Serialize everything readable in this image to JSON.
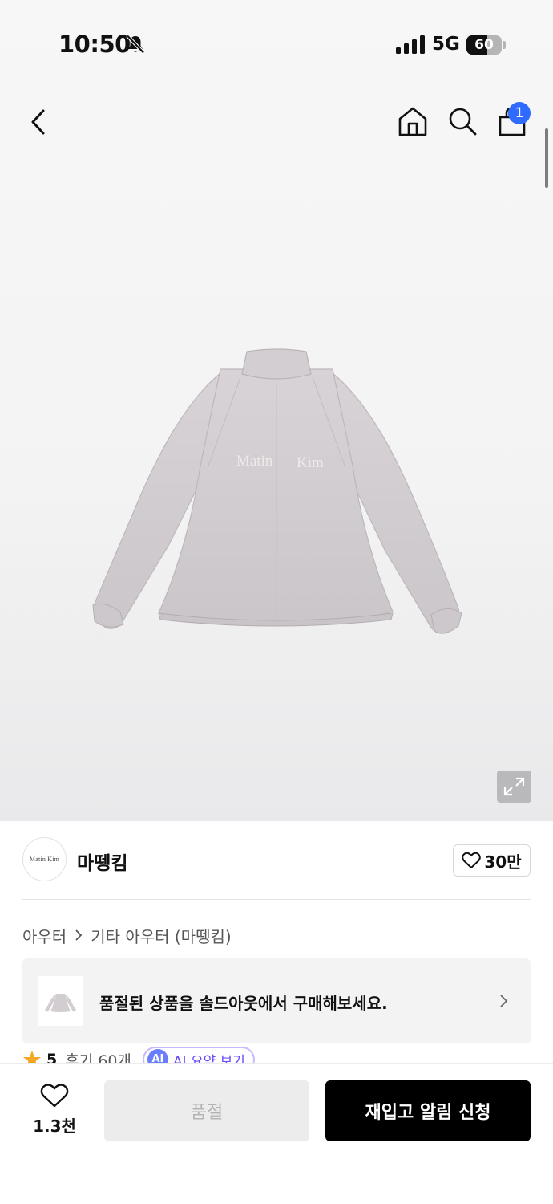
{
  "status_bar": {
    "time": "10:50",
    "network": "5G",
    "battery_level": "60",
    "battery_fraction": 0.6,
    "icons": [
      "bell-slash-icon",
      "cellular-signal-icon",
      "battery-icon"
    ]
  },
  "nav": {
    "icons": [
      "back-arrow-icon",
      "home-icon",
      "search-icon",
      "shopping-bag-icon"
    ],
    "cart_count": "1"
  },
  "product_image": {
    "print_text_1": "Matin",
    "print_text_2": "Kim",
    "zoom_icon": "expand-icon"
  },
  "brand": {
    "logo_text": "Matin  Kim",
    "name": "마뗑킴",
    "like_count": "30만"
  },
  "breadcrumb": {
    "items": [
      "아우터",
      "기타 아우터 (마뗑킴)"
    ]
  },
  "soldout_banner": {
    "text": "품절된 상품을 솔드아웃에서 구매해보세요."
  },
  "rating": {
    "score": "5",
    "reviews": "후기 60개",
    "ai_badge": "AI",
    "ai_label": "AI 요약 보기"
  },
  "bottom_bar": {
    "wish_count": "1.3천",
    "soldout_label": "품절",
    "restock_label": "재입고 알림 신청"
  },
  "colors": {
    "accent_blue": "#2f6bff",
    "primary_button": "#000000",
    "disabled_button": "#ececec",
    "ai_purple": "#6b4cff"
  }
}
